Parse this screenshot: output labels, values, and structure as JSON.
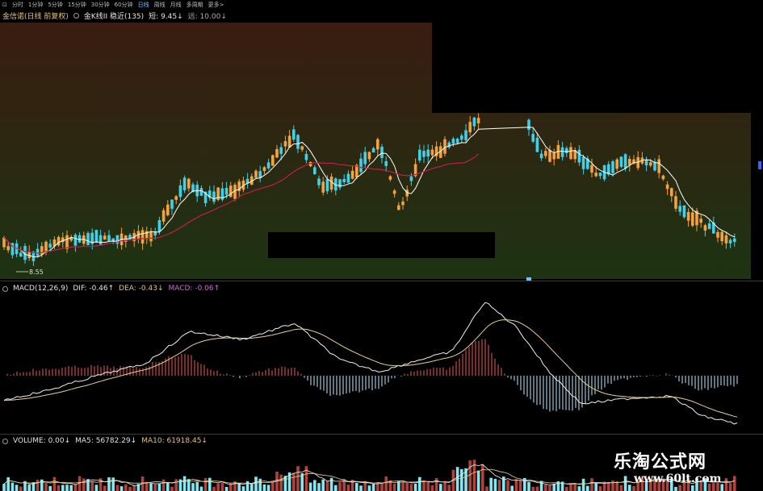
{
  "toolbar": {
    "tabs": [
      {
        "label": "分时",
        "active": false
      },
      {
        "label": "1分钟",
        "active": false
      },
      {
        "label": "5分钟",
        "active": false
      },
      {
        "label": "15分钟",
        "active": false
      },
      {
        "label": "30分钟",
        "active": false
      },
      {
        "label": "60分钟",
        "active": false
      },
      {
        "label": "日线",
        "active": true
      },
      {
        "label": "周线",
        "active": false
      },
      {
        "label": "月线",
        "active": false
      },
      {
        "label": "多周期",
        "active": false
      },
      {
        "label": "更多>",
        "active": false
      }
    ]
  },
  "main_panel": {
    "stock_name": "金信诺(日线 前复权)",
    "indicator_name": "金K线II 稳近(135)",
    "short_label": "短: 9.45",
    "short_arrow": "↓",
    "far_label": "远: 10.00",
    "far_arrow": "↓",
    "low_price_label": "8.55",
    "colors": {
      "up_candle": "#f5a23a",
      "down_candle": "#3fd0ea",
      "ma_short": "#ffffff",
      "ma_long": "#c0204a",
      "bg_top": "#3a1c10",
      "bg_bottom": "#1d3312"
    }
  },
  "macd_panel": {
    "name": "MACD(12,26,9)",
    "dif": "DIF: -0.46",
    "dif_arrow": "↑",
    "dea": "DEA: -0.43",
    "dea_arrow": "↓",
    "macd": "MACD: -0.06",
    "macd_arrow": "↑"
  },
  "volume_panel": {
    "name": "VOLUME: 0.00",
    "name_arrow": "↓",
    "ma5": "MA5: 56782.29",
    "ma5_arrow": "↓",
    "ma10": "MA10: 61918.45",
    "ma10_arrow": "↓"
  },
  "watermark": {
    "title": "乐淘公式网",
    "url": "www.60lt.com"
  }
}
